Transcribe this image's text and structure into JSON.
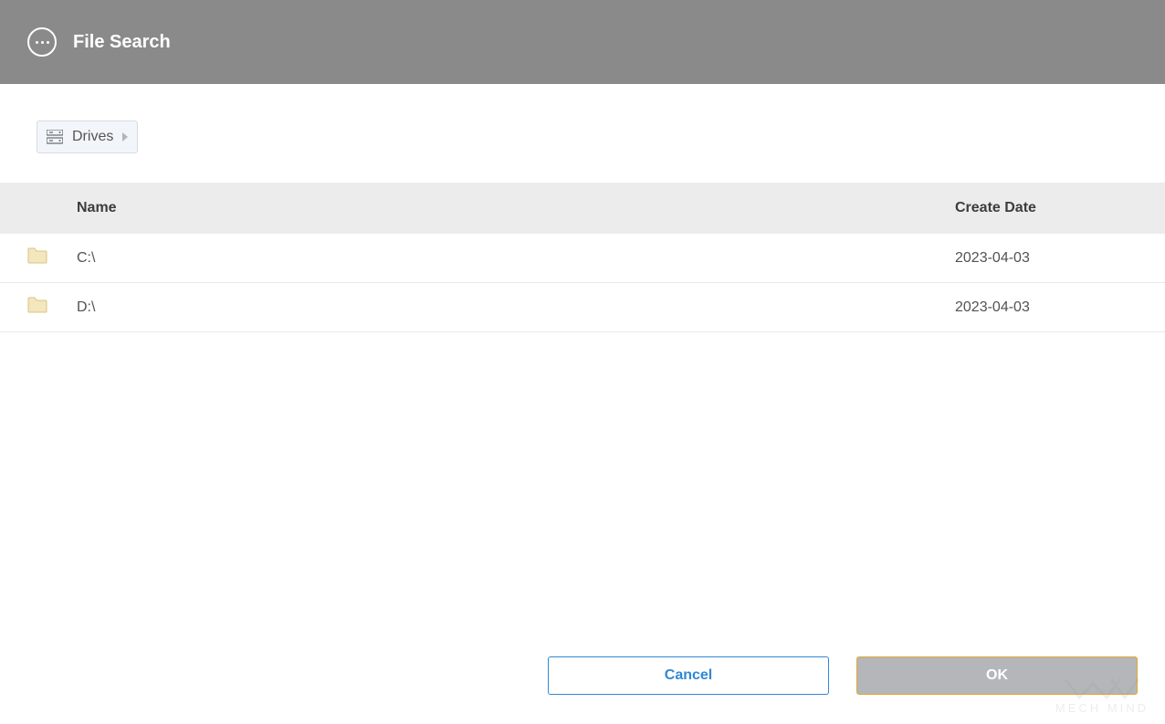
{
  "header": {
    "title": "File Search"
  },
  "breadcrumb": {
    "label": "Drives"
  },
  "table": {
    "columns": {
      "name": "Name",
      "create_date": "Create Date"
    },
    "rows": [
      {
        "name": "C:\\",
        "create_date": "2023-04-03"
      },
      {
        "name": "D:\\",
        "create_date": "2023-04-03"
      }
    ]
  },
  "buttons": {
    "cancel": "Cancel",
    "ok": "OK"
  },
  "watermark": {
    "text": "MECH MIND"
  }
}
